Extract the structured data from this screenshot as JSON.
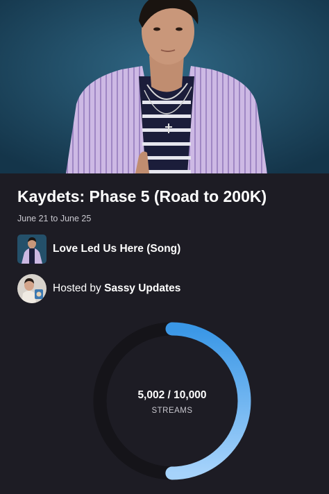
{
  "hero": {
    "image": "artist-photo"
  },
  "event": {
    "title": "Kaydets: Phase 5 (Road to 200K)",
    "dates": "June 21 to June 25"
  },
  "song": {
    "label": "Love Led Us Here (Song)",
    "thumbnail": "song-cover-thumbnail"
  },
  "host": {
    "prefix": "Hosted by ",
    "name": "Sassy Updates",
    "avatar": "host-avatar"
  },
  "progress": {
    "count_text": "5,002 / 10,000",
    "unit": "STREAMS",
    "current": 5002,
    "goal": 10000
  },
  "colors": {
    "background": "#1d1c24",
    "ring_track": "#151419",
    "ring_fill_start": "#3a97e6",
    "ring_fill_end": "#a6d3fb",
    "text_secondary": "#c9c8cf"
  }
}
